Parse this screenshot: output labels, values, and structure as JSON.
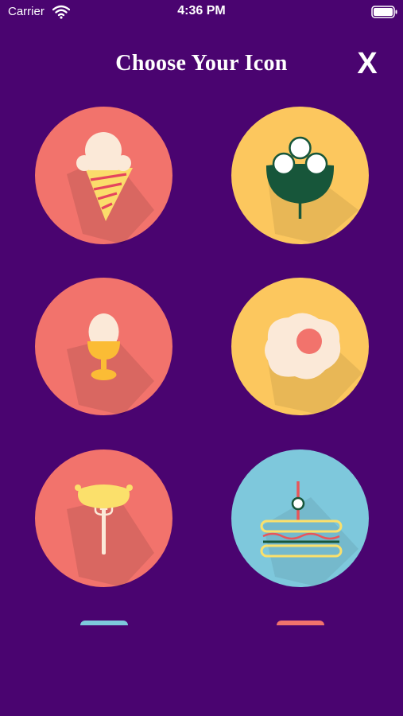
{
  "status_bar": {
    "carrier": "Carrier",
    "time": "4:36 PM",
    "wifi_icon": "wifi-icon",
    "battery_icon": "battery-icon"
  },
  "header": {
    "title": "Choose Your Icon",
    "close_label": "X"
  },
  "colors": {
    "background": "#4a0470",
    "coral": "#f2736c",
    "yellow": "#fcc75e",
    "sky": "#7ec8dc"
  },
  "icons": [
    {
      "name": "ice-cream-icon",
      "color": "#f2736c"
    },
    {
      "name": "plant-icon",
      "color": "#fcc75e"
    },
    {
      "name": "boiled-egg-icon",
      "color": "#f2736c"
    },
    {
      "name": "fried-egg-icon",
      "color": "#fcc75e"
    },
    {
      "name": "sausage-fork-icon",
      "color": "#f2736c"
    },
    {
      "name": "sandwich-icon",
      "color": "#7ec8dc"
    },
    {
      "name": "partial-icon",
      "color": "#7ec8dc"
    },
    {
      "name": "partial-icon",
      "color": "#f2736c"
    }
  ]
}
